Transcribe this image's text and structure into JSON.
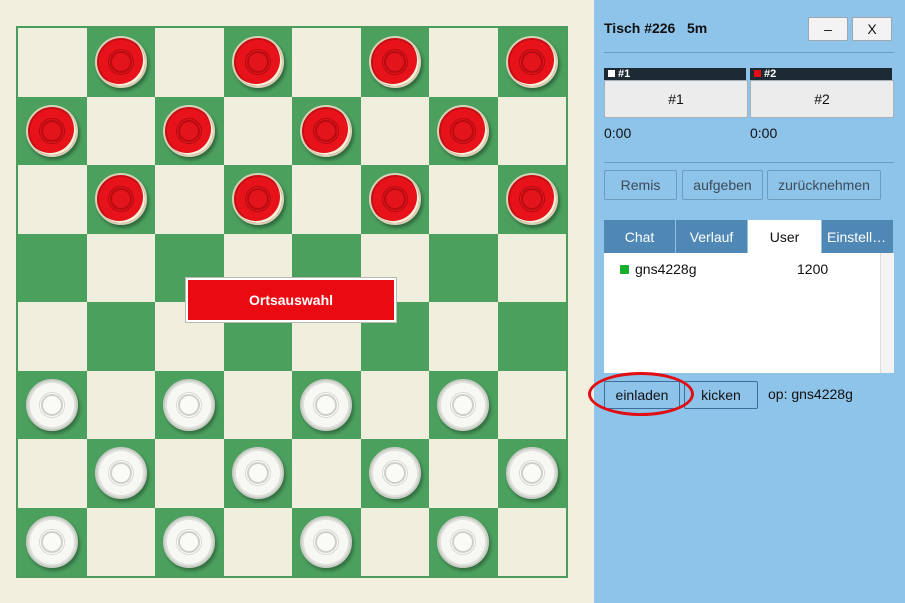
{
  "board": {
    "size": 8,
    "light_color": "#f0eedd",
    "dark_color": "#4ba05e",
    "red_pieces": [
      [
        0,
        1
      ],
      [
        0,
        3
      ],
      [
        0,
        5
      ],
      [
        0,
        7
      ],
      [
        1,
        0
      ],
      [
        1,
        2
      ],
      [
        1,
        4
      ],
      [
        1,
        6
      ],
      [
        2,
        1
      ],
      [
        2,
        3
      ],
      [
        2,
        5
      ],
      [
        2,
        7
      ]
    ],
    "white_pieces": [
      [
        5,
        0
      ],
      [
        5,
        2
      ],
      [
        5,
        4
      ],
      [
        5,
        6
      ],
      [
        6,
        1
      ],
      [
        6,
        3
      ],
      [
        6,
        5
      ],
      [
        6,
        7
      ],
      [
        7,
        0
      ],
      [
        7,
        2
      ],
      [
        7,
        4
      ],
      [
        7,
        6
      ]
    ],
    "place_button_label": "Ortsauswahl"
  },
  "panel": {
    "title": "Tisch #226   5m",
    "minimize_label": "–",
    "close_label": "X",
    "players": [
      {
        "tag": "#1",
        "marker_color": "#ffffff",
        "button_label": "#1",
        "clock": "0:00"
      },
      {
        "tag": "#2",
        "marker_color": "#e00d12",
        "button_label": "#2",
        "clock": "0:00"
      }
    ],
    "actions": {
      "remis": "Remis",
      "resign": "aufgeben",
      "undo": "zurücknehmen"
    },
    "tabs": [
      {
        "label": "Chat",
        "active": false
      },
      {
        "label": "Verlauf",
        "active": false
      },
      {
        "label": "User",
        "active": true
      },
      {
        "label": "Einstell…",
        "active": false
      }
    ],
    "users": [
      {
        "name": "gns4228g",
        "rating": "1200",
        "status_color": "#17b02c"
      }
    ],
    "invite_label": "einladen",
    "kick_label": "kicken",
    "op_text": "op: gns4228g"
  }
}
